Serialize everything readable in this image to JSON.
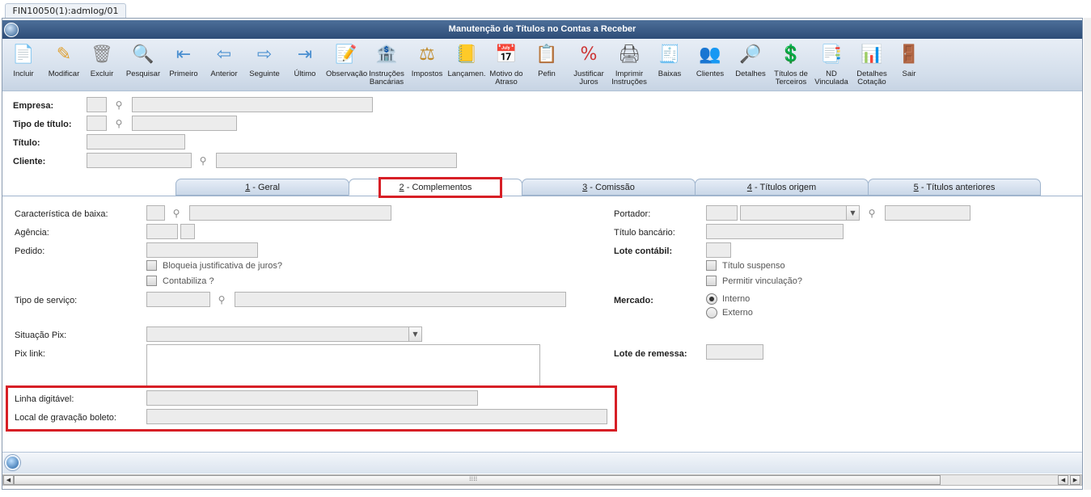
{
  "program_tab": "FIN10050(1):admlog/01",
  "window_title": "Manutenção de Títulos no Contas a Receber",
  "toolbar": [
    {
      "label": "Incluir",
      "icon": "add-document-icon",
      "glyph": "📄"
    },
    {
      "label": "Modificar",
      "icon": "edit-document-icon",
      "glyph": "✎"
    },
    {
      "label": "Excluir",
      "icon": "trash-icon",
      "glyph": "🗑"
    },
    {
      "label": "Pesquisar",
      "icon": "magnifier-icon",
      "glyph": "🔍"
    },
    {
      "label": "Primeiro",
      "icon": "first-arrow-icon",
      "glyph": "⇤"
    },
    {
      "label": "Anterior",
      "icon": "previous-arrow-icon",
      "glyph": "⇦"
    },
    {
      "label": "Seguinte",
      "icon": "next-arrow-icon",
      "glyph": "⇨"
    },
    {
      "label": "Último",
      "icon": "last-arrow-icon",
      "glyph": "⇥"
    },
    {
      "label": "Observação",
      "icon": "observation-icon",
      "glyph": "📝"
    },
    {
      "label": "Instruções\nBancárias",
      "icon": "bank-instructions-icon",
      "glyph": "🏦"
    },
    {
      "label": "Impostos",
      "icon": "tax-scale-icon",
      "glyph": "⚖"
    },
    {
      "label": "Lançamen.",
      "icon": "entries-icon",
      "glyph": "📒"
    },
    {
      "label": "Motivo do\nAtraso",
      "icon": "delay-reason-icon",
      "glyph": "📅"
    },
    {
      "label": "Pefin",
      "icon": "pefin-icon",
      "glyph": "📋"
    },
    {
      "label": "Justificar\nJuros",
      "icon": "justify-interest-icon",
      "glyph": "%"
    },
    {
      "label": "Imprimir\nInstruções",
      "icon": "printer-icon",
      "glyph": "🖨"
    },
    {
      "label": "Baixas",
      "icon": "write-off-icon",
      "glyph": "🧾"
    },
    {
      "label": "Clientes",
      "icon": "customers-icon",
      "glyph": "👥"
    },
    {
      "label": "Detalhes",
      "icon": "details-icon",
      "glyph": "🔎"
    },
    {
      "label": "Títulos de\nTerceiros",
      "icon": "third-party-titles-icon",
      "glyph": "💲"
    },
    {
      "label": "ND\nVinculada",
      "icon": "linked-debit-note-icon",
      "glyph": "📑"
    },
    {
      "label": "Detalhes\nCotação",
      "icon": "quote-details-icon",
      "glyph": "📊"
    },
    {
      "label": "Sair",
      "icon": "exit-door-icon",
      "glyph": "🚪"
    }
  ],
  "header": {
    "empresa_label": "Empresa:",
    "tipo_titulo_label": "Tipo de título:",
    "titulo_label": "Título:",
    "cliente_label": "Cliente:"
  },
  "tabs": [
    {
      "key": "1",
      "rest": " - Geral"
    },
    {
      "key": "2",
      "rest": " - Complementos"
    },
    {
      "key": "3",
      "rest": " - Comissão"
    },
    {
      "key": "4",
      "rest": " - Títulos origem"
    },
    {
      "key": "5",
      "rest": " - Títulos anteriores"
    }
  ],
  "complementos": {
    "caracteristica_baixa": "Característica de baixa:",
    "agencia": "Agência:",
    "pedido": "Pedido:",
    "bloqueia_juros": "Bloqueia justificativa de juros?",
    "contabiliza": "Contabiliza ?",
    "tipo_servico": "Tipo de serviço:",
    "situacao_pix": "Situação Pix:",
    "pix_link": "Pix link:",
    "linha_digitavel": "Linha digitável:",
    "local_gravacao": "Local de gravação boleto:",
    "portador": "Portador:",
    "titulo_bancario": "Título bancário:",
    "lote_contabil": "Lote contábil:",
    "titulo_suspenso": "Título suspenso",
    "permitir_vinculacao": "Permitir vinculação?",
    "mercado": "Mercado:",
    "interno": "Interno",
    "externo": "Externo",
    "lote_remessa": "Lote de remessa:"
  },
  "scroll_grip": "⁞⁞⁞⁞"
}
